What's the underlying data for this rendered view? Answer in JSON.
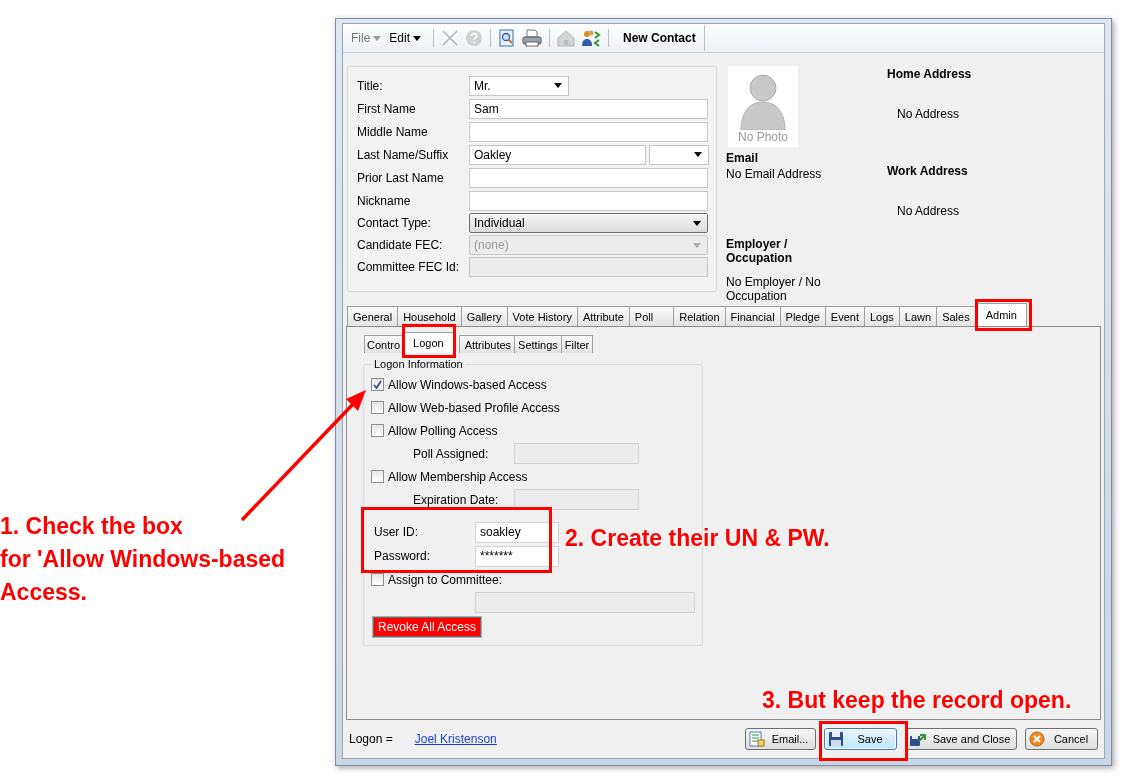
{
  "toolbar": {
    "menus": [
      {
        "label": "File",
        "disabled": true
      },
      {
        "label": "Edit",
        "disabled": false
      }
    ],
    "tools": [
      {
        "kind": "delete",
        "disabled": true
      },
      {
        "kind": "help",
        "disabled": true
      },
      {
        "kind": "preview",
        "disabled": false
      },
      {
        "kind": "print",
        "disabled": false
      },
      {
        "kind": "home",
        "disabled": true
      },
      {
        "kind": "people",
        "disabled": false
      }
    ],
    "document_tab": "New Contact"
  },
  "contact_form": {
    "fields": [
      {
        "label": "Title:",
        "kind": "select",
        "value": "Mr.",
        "disabled": false
      },
      {
        "label": "First Name",
        "kind": "text",
        "value": "Sam",
        "disabled": false
      },
      {
        "label": "Middle Name",
        "kind": "text",
        "disabled": false
      },
      {
        "label": "Last Name/Suffix",
        "kind": "text_select",
        "value": "Oakley",
        "disabled": false
      },
      {
        "label": "Prior Last Name",
        "kind": "text",
        "disabled": false
      },
      {
        "label": "Nickname",
        "kind": "text",
        "disabled": false
      },
      {
        "label": "Contact Type:",
        "kind": "combo",
        "value": "Individual",
        "disabled": false
      },
      {
        "label": "Candidate FEC:",
        "kind": "combo",
        "value": "(none)",
        "disabled": true
      },
      {
        "label": "Committee FEC Id:",
        "kind": "text",
        "disabled": true
      }
    ]
  },
  "photo": {
    "caption": "No Photo"
  },
  "email": {
    "heading": "Email",
    "value": "No Email Address"
  },
  "employer": {
    "heading": "Employer / Occupation",
    "value": "No Employer / No Occupation"
  },
  "home_address": {
    "heading": "Home Address",
    "value": "No Address"
  },
  "work_address": {
    "heading": "Work Address",
    "value": "No Address"
  },
  "tabs": [
    {
      "label": "General",
      "selected": false
    },
    {
      "label": "Household",
      "selected": false
    },
    {
      "label": "Gallery",
      "selected": false
    },
    {
      "label": "Vote History",
      "selected": false
    },
    {
      "label": "Attribute",
      "selected": false
    },
    {
      "label": "Poll",
      "selected": false
    },
    {
      "label": "Relation",
      "selected": false
    },
    {
      "label": "Financial",
      "selected": false
    },
    {
      "label": "Pledge",
      "selected": false
    },
    {
      "label": "Event",
      "selected": false
    },
    {
      "label": "Logs",
      "selected": false
    },
    {
      "label": "Lawn",
      "selected": false
    },
    {
      "label": "Sales",
      "selected": false
    },
    {
      "label": "Admin",
      "selected": true
    }
  ],
  "subtabs": [
    {
      "label": "Contro",
      "selected": false
    },
    {
      "label": "Logon",
      "selected": true
    },
    {
      "label": "Attributes",
      "selected": false
    },
    {
      "label": "Settings",
      "selected": false
    },
    {
      "label": "Filter",
      "selected": false
    }
  ],
  "logon_group": {
    "legend": "Logon Information",
    "items": [
      {
        "kind": "checkbox",
        "label": "Allow Windows-based Access",
        "checked": true
      },
      {
        "kind": "checkbox",
        "label": "Allow Web-based Profile Access",
        "checked": false
      },
      {
        "kind": "checkbox",
        "label": "Allow Polling Access",
        "checked": false
      },
      {
        "kind": "sub_field",
        "label": "Poll Assigned:"
      },
      {
        "kind": "checkbox",
        "label": "Allow Membership Access",
        "checked": false
      },
      {
        "kind": "sub_field",
        "label": "Expiration Date:"
      },
      {
        "kind": "field",
        "label": "User ID:",
        "value": "soakley"
      },
      {
        "kind": "field",
        "label": "Password:",
        "value": "*******"
      },
      {
        "kind": "checkbox",
        "label": "Assign to Committee:",
        "checked": false
      },
      {
        "kind": "blank_field"
      },
      {
        "kind": "button",
        "label": "Revoke All Access"
      }
    ]
  },
  "footer": {
    "logon_label": "Logon =",
    "user_link": "Joel Kristenson",
    "buttons": [
      {
        "kind": "email",
        "label": "Email...",
        "focused": false
      },
      {
        "kind": "save",
        "label": "Save",
        "focused": true
      },
      {
        "kind": "save_close",
        "label": "Save and Close",
        "focused": false
      },
      {
        "kind": "cancel",
        "label": "Cancel",
        "focused": false
      }
    ]
  },
  "annotations": [
    {
      "kind": "step_left",
      "text": "1. Check the box\nfor 'Allow Windows-based\nAccess."
    },
    {
      "kind": "step_middle",
      "text": "2. Create their UN & PW."
    },
    {
      "kind": "step_bottom",
      "text": "3. But keep the record open."
    }
  ]
}
